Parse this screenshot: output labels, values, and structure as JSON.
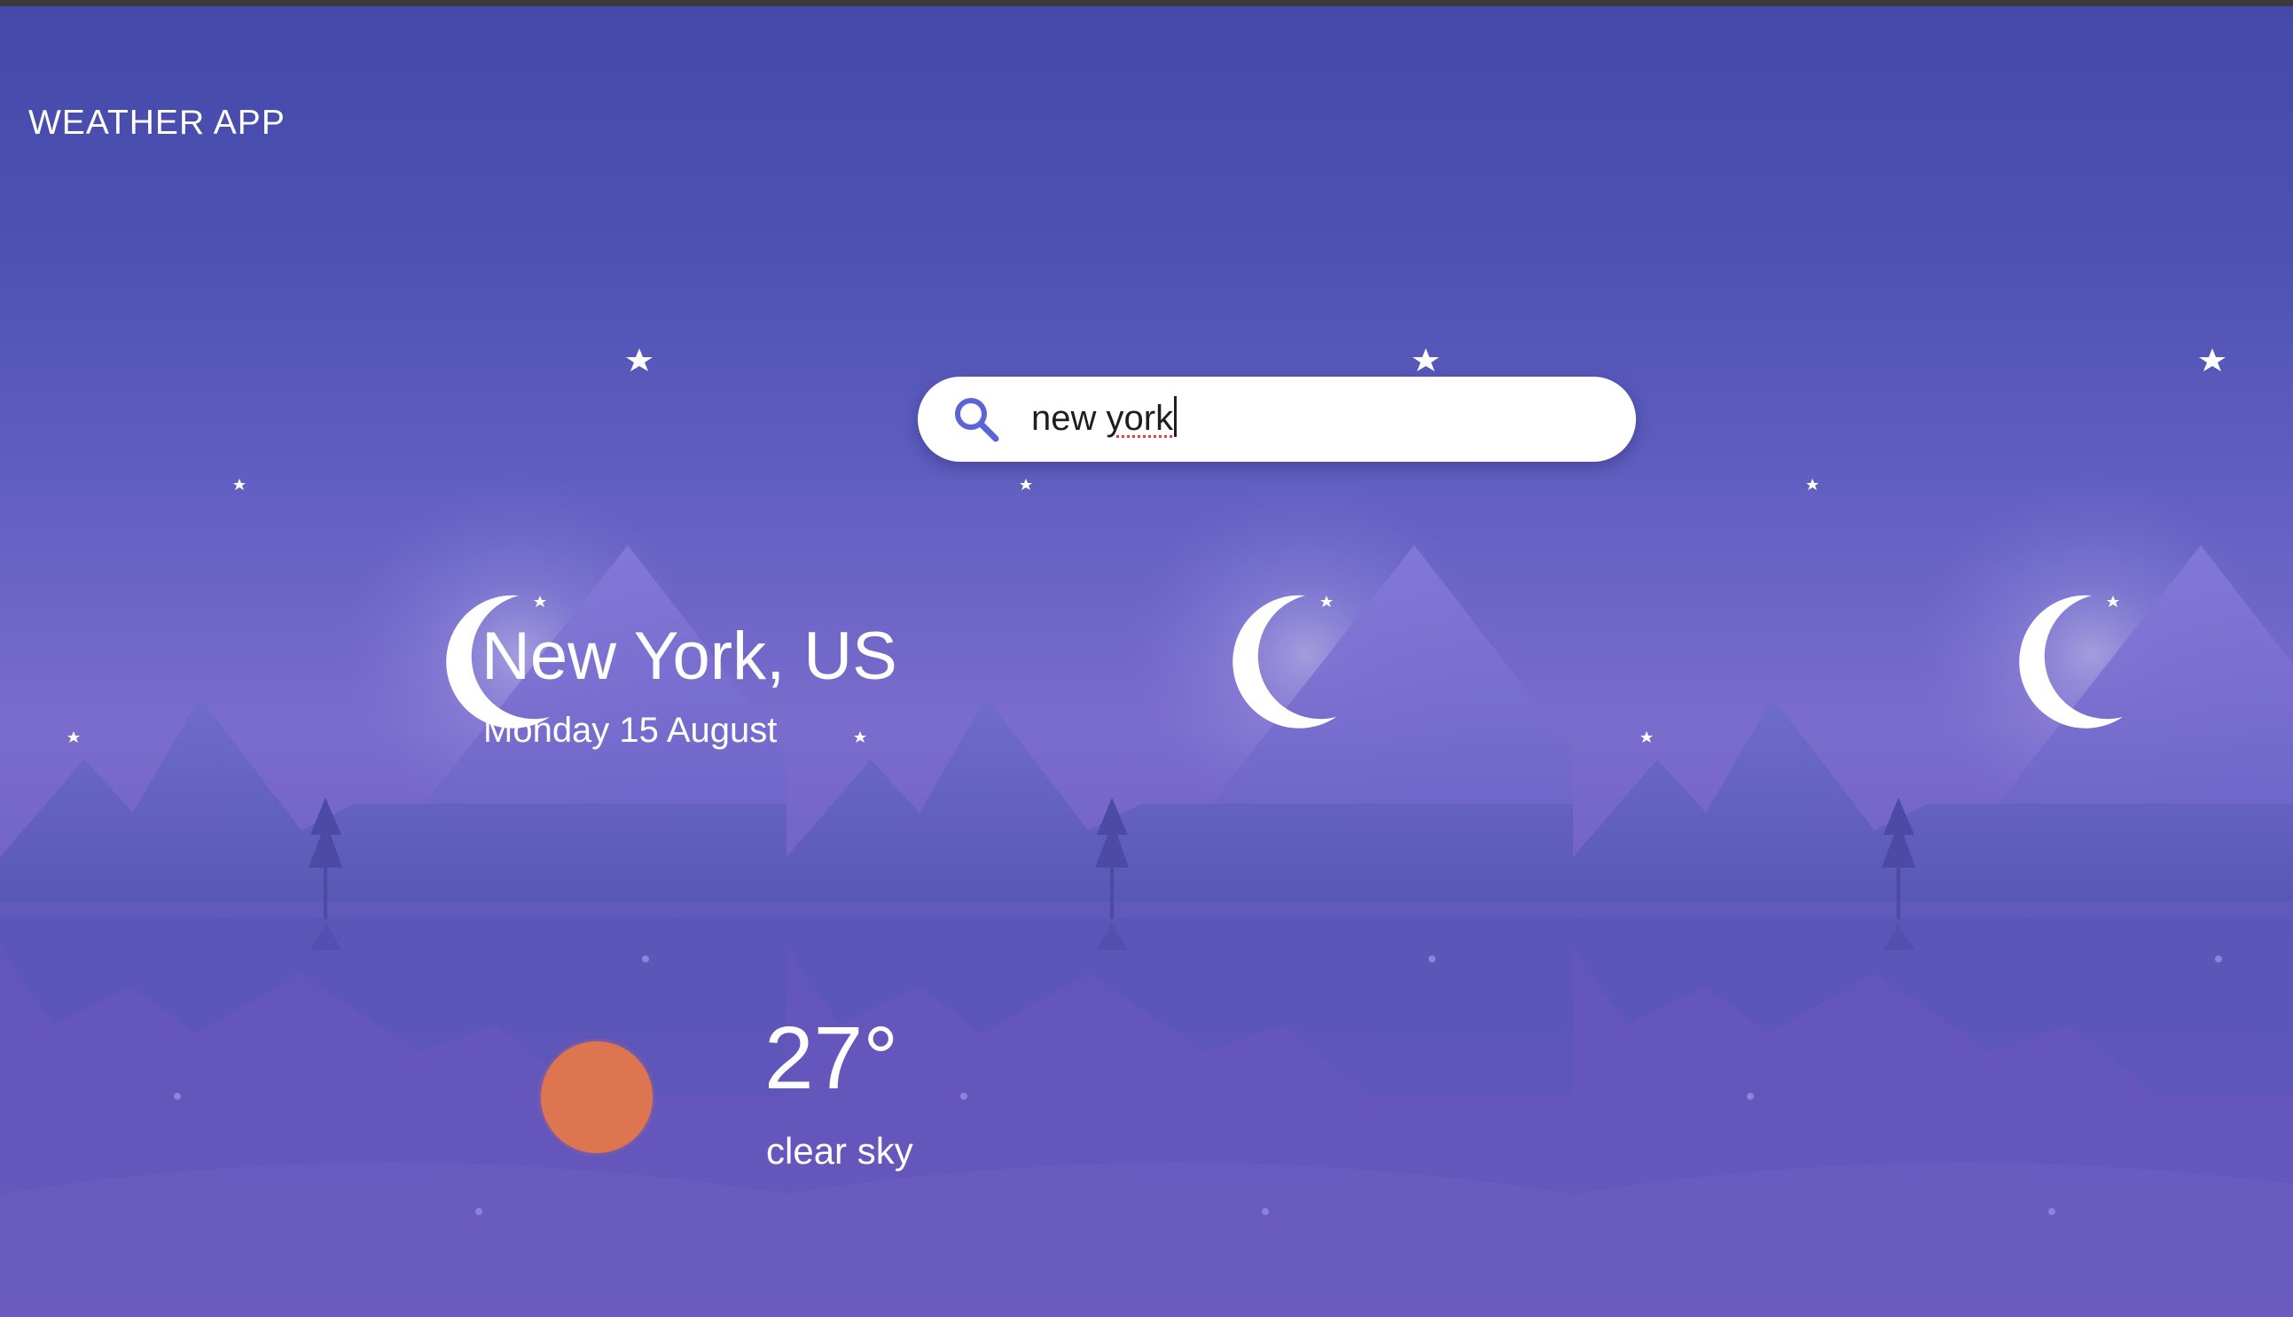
{
  "app": {
    "title": "WEATHER APP"
  },
  "search": {
    "value": "new york",
    "value_first_word": "new",
    "value_misspelled_word": "york",
    "placeholder": ""
  },
  "location": {
    "city": "New York, US",
    "date": "Monday 15 August"
  },
  "weather": {
    "temperature": "27°",
    "description": "clear sky",
    "icon": "sun-icon"
  },
  "colors": {
    "sky_top": "#4549a9",
    "sky_mid": "#7a6ccc",
    "sun": "#de7551",
    "search_icon": "#5b63d6",
    "text": "#ffffff"
  }
}
